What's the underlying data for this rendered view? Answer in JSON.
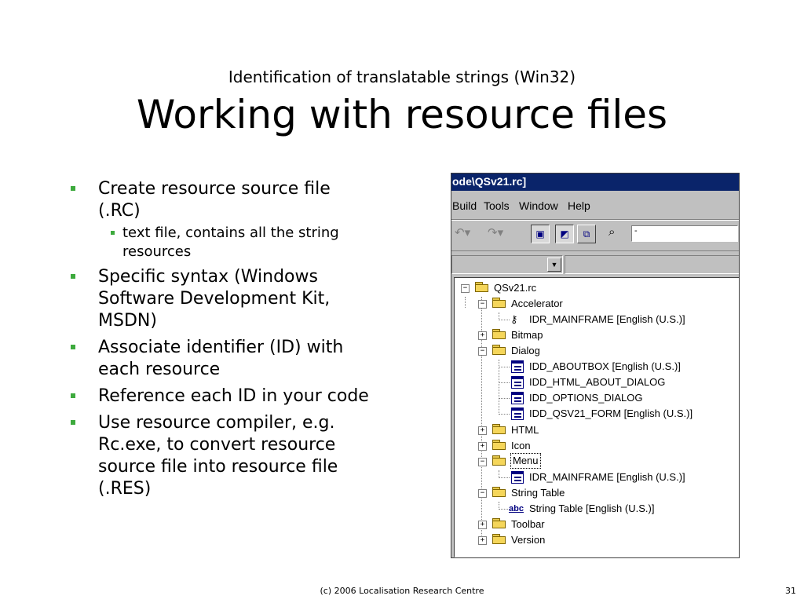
{
  "subtitle": "Identification of translatable strings (Win32)",
  "title": "Working with resource files",
  "bullets": [
    {
      "text": "Create resource source file (.RC)",
      "sub": [
        "text file, contains all the string resources"
      ]
    },
    {
      "text": "Specific syntax (Windows Software Development Kit, MSDN)"
    },
    {
      "text": "Associate identifier (ID) with each resource"
    },
    {
      "text": "Reference each ID in your code"
    },
    {
      "text": "Use resource compiler, e.g. Rc.exe, to convert resource source file into resource file (.RES)"
    }
  ],
  "window": {
    "title": "ode\\QSv21.rc]",
    "menu": [
      "Build",
      "Tools",
      "Window",
      "Help"
    ],
    "combo_value": "-",
    "tree": {
      "root": "QSv21.rc",
      "accelerator": "Accelerator",
      "accel_item": "IDR_MAINFRAME [English (U.S.)]",
      "bitmap": "Bitmap",
      "dialog": "Dialog",
      "dialog_items": [
        "IDD_ABOUTBOX [English (U.S.)]",
        "IDD_HTML_ABOUT_DIALOG",
        "IDD_OPTIONS_DIALOG",
        "IDD_QSV21_FORM [English (U.S.)]"
      ],
      "html": "HTML",
      "icon": "Icon",
      "menu": "Menu",
      "menu_item": "IDR_MAINFRAME [English (U.S.)]",
      "string_table": "String Table",
      "string_item": "String Table [English (U.S.)]",
      "abc_label": "abc",
      "toolbar": "Toolbar",
      "version": "Version"
    }
  },
  "footer": "(c) 2006 Localisation Research Centre",
  "page_number": "31",
  "colors": {
    "bullet": "#3daa3d",
    "titlebar": "#0a246a",
    "folder": "#f5d65a"
  }
}
